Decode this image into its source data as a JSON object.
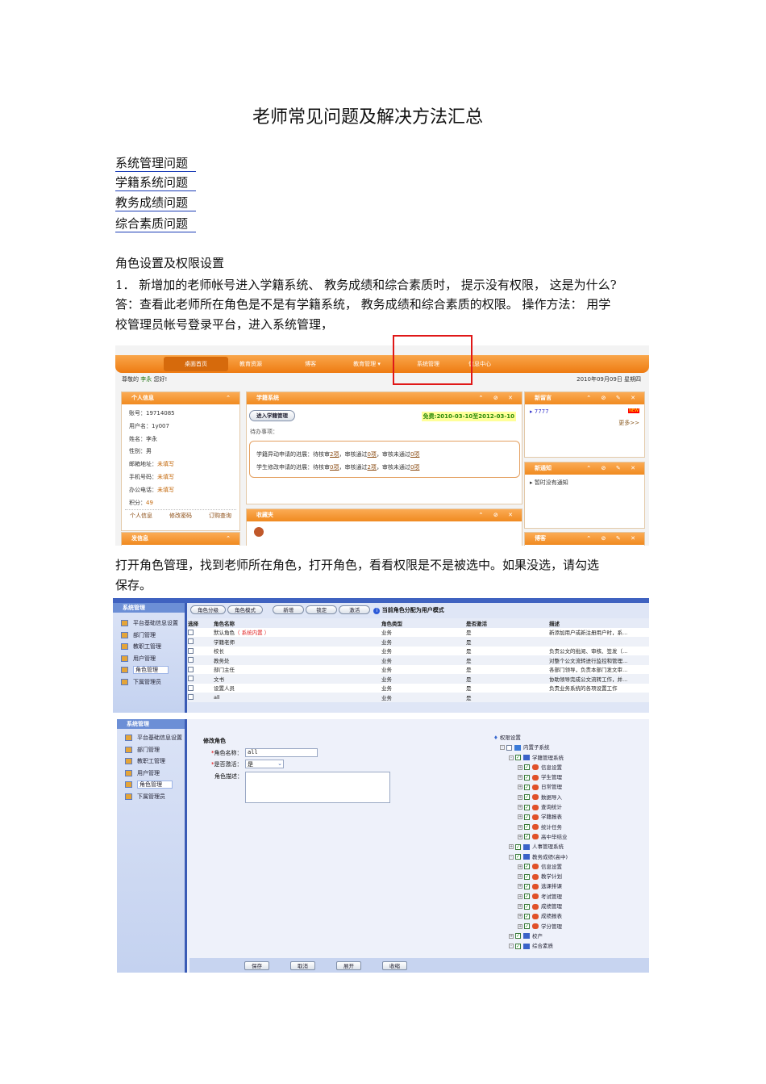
{
  "title": "老师常见问题及解决方法汇总",
  "toc": [
    "系统管理问题",
    "学籍系统问题",
    "教务成绩问题",
    "综合素质问题"
  ],
  "section": "角色设置及权限设置",
  "para1": [
    "1．  新增加的老师帐号进入学籍系统、     教务成绩和综合素质时，    提示没有权限，    这是为什么?",
    "答：查看此老师所在角色是不是有学籍系统，        教务成绩和综合素质的权限。      操作方法：  用学",
    "校管理员帐号登录平台，进入系统管理，"
  ],
  "para2": [
    "打开角色管理，找到老师所在角色，打开角色，看看权限是不是被选中。如果没选，请勾选",
    "保存。"
  ],
  "shot1": {
    "nav": [
      "桌面首页",
      "教育资源",
      "博客",
      "教育管理 ▾",
      "系统管理",
      "信息中心"
    ],
    "greeting_pre": "尊敬的",
    "greeting_name": "李永",
    "greeting_post": "您好!",
    "date": "2010年09月09日  星期四",
    "personal": {
      "title": "个人信息",
      "rows": [
        [
          "账号：",
          "19714085"
        ],
        [
          "用户名：",
          "1y007"
        ],
        [
          "姓名：",
          "李永"
        ],
        [
          "性别：",
          "男"
        ],
        [
          "邮箱地址：",
          "未填写"
        ],
        [
          "手机号码：",
          "未填写"
        ],
        [
          "办公电话：",
          "未填写"
        ],
        [
          "积分：",
          "49"
        ]
      ],
      "links": [
        "个人信息",
        "修改密码",
        "订购查询"
      ]
    },
    "send": "发信息",
    "xj": {
      "title": "学籍系统",
      "enter": "进入学籍管理",
      "free": "免费:2010-03-10至2012-03-10",
      "todo": "待办事项：",
      "l1": [
        "学籍异动申请的进展：待核审",
        "2项",
        "，审核通过",
        "0项",
        "，审核未通过",
        "0项"
      ],
      "l2": [
        "学生修改申请的进展：待核审",
        "0项",
        "，审核通过",
        "2项",
        "，审核未通过",
        "0项"
      ]
    },
    "fav": "收藏夹",
    "msg": {
      "title": "新留言",
      "item": "7777",
      "badge": "NEW",
      "more": "更多>>"
    },
    "notice": {
      "title": "新通知",
      "item": "暂时没有通知"
    },
    "blog": "博客"
  },
  "sidebar": {
    "title": "系统管理",
    "items": [
      "平台基础信息设置",
      "部门管理",
      "教职工管理",
      "用户管理",
      "角色管理",
      "下属管理员"
    ]
  },
  "shot2": {
    "buttons": [
      "角色分级",
      "角色模式",
      "新增",
      "锁定",
      "激活"
    ],
    "info": "当前角色分配为用户模式",
    "headers": [
      "选择",
      "角色名称",
      "角色类型",
      "是否激活",
      "描述"
    ],
    "builtin": "（ 系统内置 ）",
    "rows": [
      [
        "默认角色",
        "业务",
        "是",
        "新添加用户或新注册用户时，系..."
      ],
      [
        "学籍老师",
        "业务",
        "是",
        ""
      ],
      [
        "校长",
        "业务",
        "是",
        "负责公文的批阅、审核、签发（..."
      ],
      [
        "教务处",
        "业务",
        "是",
        "对整个公文流转进行监控和管理..."
      ],
      [
        "部门主任",
        "业务",
        "是",
        "各部门领导，负责本部门发文审..."
      ],
      [
        "文书",
        "业务",
        "是",
        "协助领导完成公文流转工作，并..."
      ],
      [
        "设置人员",
        "业务",
        "是",
        "负责业务系统的各项设置工作"
      ],
      [
        "all",
        "业务",
        "是",
        ""
      ]
    ]
  },
  "shot3": {
    "form_title": "修改角色",
    "name_label": "角色名称：",
    "name_value": "all",
    "active_label": "是否激活：",
    "active_value": "是",
    "desc_label": "角色描述：",
    "tree_root": "权限设置",
    "tree": [
      [
        1,
        "内置子系统",
        "-",
        false
      ],
      [
        2,
        "学籍管理系统",
        "-",
        true
      ],
      [
        3,
        "信息设置",
        "+",
        true
      ],
      [
        3,
        "学生管理",
        "+",
        true
      ],
      [
        3,
        "日常管理",
        "+",
        true
      ],
      [
        3,
        "数据导入",
        "+",
        true
      ],
      [
        3,
        "查询统计",
        "+",
        true
      ],
      [
        3,
        "学籍报表",
        "+",
        true
      ],
      [
        3,
        "统计任务",
        "+",
        true
      ],
      [
        3,
        "高中毕结业",
        "+",
        true
      ],
      [
        2,
        "人事管理系统",
        "+",
        true
      ],
      [
        2,
        "教务成绩(高中)",
        "-",
        true
      ],
      [
        3,
        "信息设置",
        "+",
        true
      ],
      [
        3,
        "教学计划",
        "+",
        true
      ],
      [
        3,
        "选课排课",
        "+",
        true
      ],
      [
        3,
        "考试管理",
        "+",
        true
      ],
      [
        3,
        "成绩管理",
        "+",
        true
      ],
      [
        3,
        "成绩报表",
        "+",
        true
      ],
      [
        3,
        "学分管理",
        "+",
        true
      ],
      [
        2,
        "校产",
        "+",
        true
      ],
      [
        2,
        "综合素质",
        "-",
        true
      ]
    ],
    "buttons": [
      "保存",
      "取消",
      "展开",
      "收缩"
    ]
  }
}
